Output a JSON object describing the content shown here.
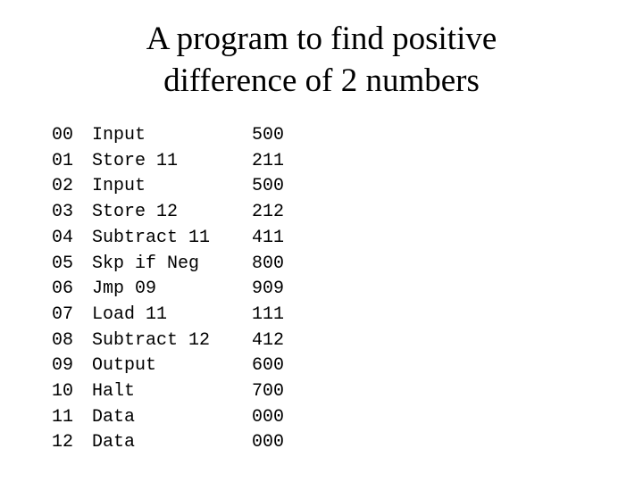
{
  "slide": {
    "background_color": "#ffffff",
    "text_color": "#000000",
    "title": {
      "full": "A program to find positive difference of 2 numbers",
      "line1": "A program to find positive",
      "line2": "difference of 2 numbers"
    },
    "listing": {
      "columns": [
        "address",
        "mnemonic",
        "machine_code"
      ],
      "rows": [
        {
          "address": "00",
          "mnemonic": "Input",
          "machine_code": "500"
        },
        {
          "address": "01",
          "mnemonic": "Store 11",
          "machine_code": "211"
        },
        {
          "address": "02",
          "mnemonic": "Input",
          "machine_code": "500"
        },
        {
          "address": "03",
          "mnemonic": "Store 12",
          "machine_code": "212"
        },
        {
          "address": "04",
          "mnemonic": "Subtract 11",
          "machine_code": "411"
        },
        {
          "address": "05",
          "mnemonic": "Skp if Neg",
          "machine_code": "800"
        },
        {
          "address": "06",
          "mnemonic": "Jmp 09",
          "machine_code": "909"
        },
        {
          "address": "07",
          "mnemonic": "Load 11",
          "machine_code": "111"
        },
        {
          "address": "08",
          "mnemonic": "Subtract 12",
          "machine_code": "412"
        },
        {
          "address": "09",
          "mnemonic": "Output",
          "machine_code": "600"
        },
        {
          "address": "10",
          "mnemonic": "Halt",
          "machine_code": "700"
        },
        {
          "address": "11",
          "mnemonic": "Data",
          "machine_code": "000"
        },
        {
          "address": "12",
          "mnemonic": "Data",
          "machine_code": "000"
        }
      ]
    }
  }
}
